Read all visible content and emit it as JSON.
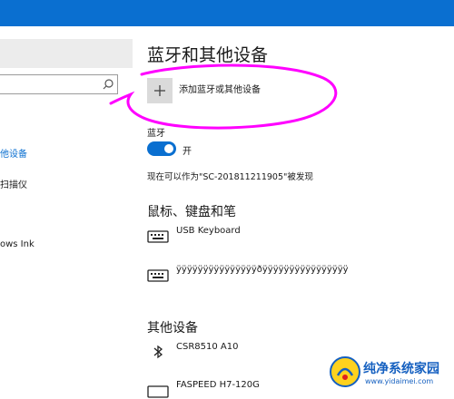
{
  "colors": {
    "accent": "#0a6fd0",
    "annotation": "#ff00ff"
  },
  "nav": {
    "search_value": "",
    "items": [
      {
        "label": "他设备",
        "active": true
      },
      {
        "label": "扫描仪",
        "active": false
      },
      {
        "label": "ows Ink",
        "active": false
      }
    ]
  },
  "main": {
    "title": "蓝牙和其他设备",
    "add_device_label": "添加蓝牙或其他设备",
    "bluetooth": {
      "label": "蓝牙",
      "toggle_state": "开",
      "discoverable_text": "现在可以作为\"SC-201811211905\"被发现"
    },
    "mouse_section": {
      "heading": "鼠标、键盘和笔",
      "devices": [
        {
          "name": "USB Keyboard",
          "icon": "keyboard-icon"
        },
        {
          "name": "ÿÿÿÿÿÿÿÿÿÿÿÿÿÿÿðÿÿÿÿÿÿÿÿÿÿÿÿÿÿÿÿ",
          "icon": "keyboard-icon"
        }
      ]
    },
    "other_section": {
      "heading": "其他设备",
      "devices": [
        {
          "name": "CSR8510 A10",
          "icon": "bluetooth-icon"
        },
        {
          "name": "FASPEED H7-120G",
          "icon": "keyboard-icon"
        }
      ]
    }
  },
  "watermark": {
    "title": "纯净系统家园",
    "url": "www.yidaimei.com"
  }
}
